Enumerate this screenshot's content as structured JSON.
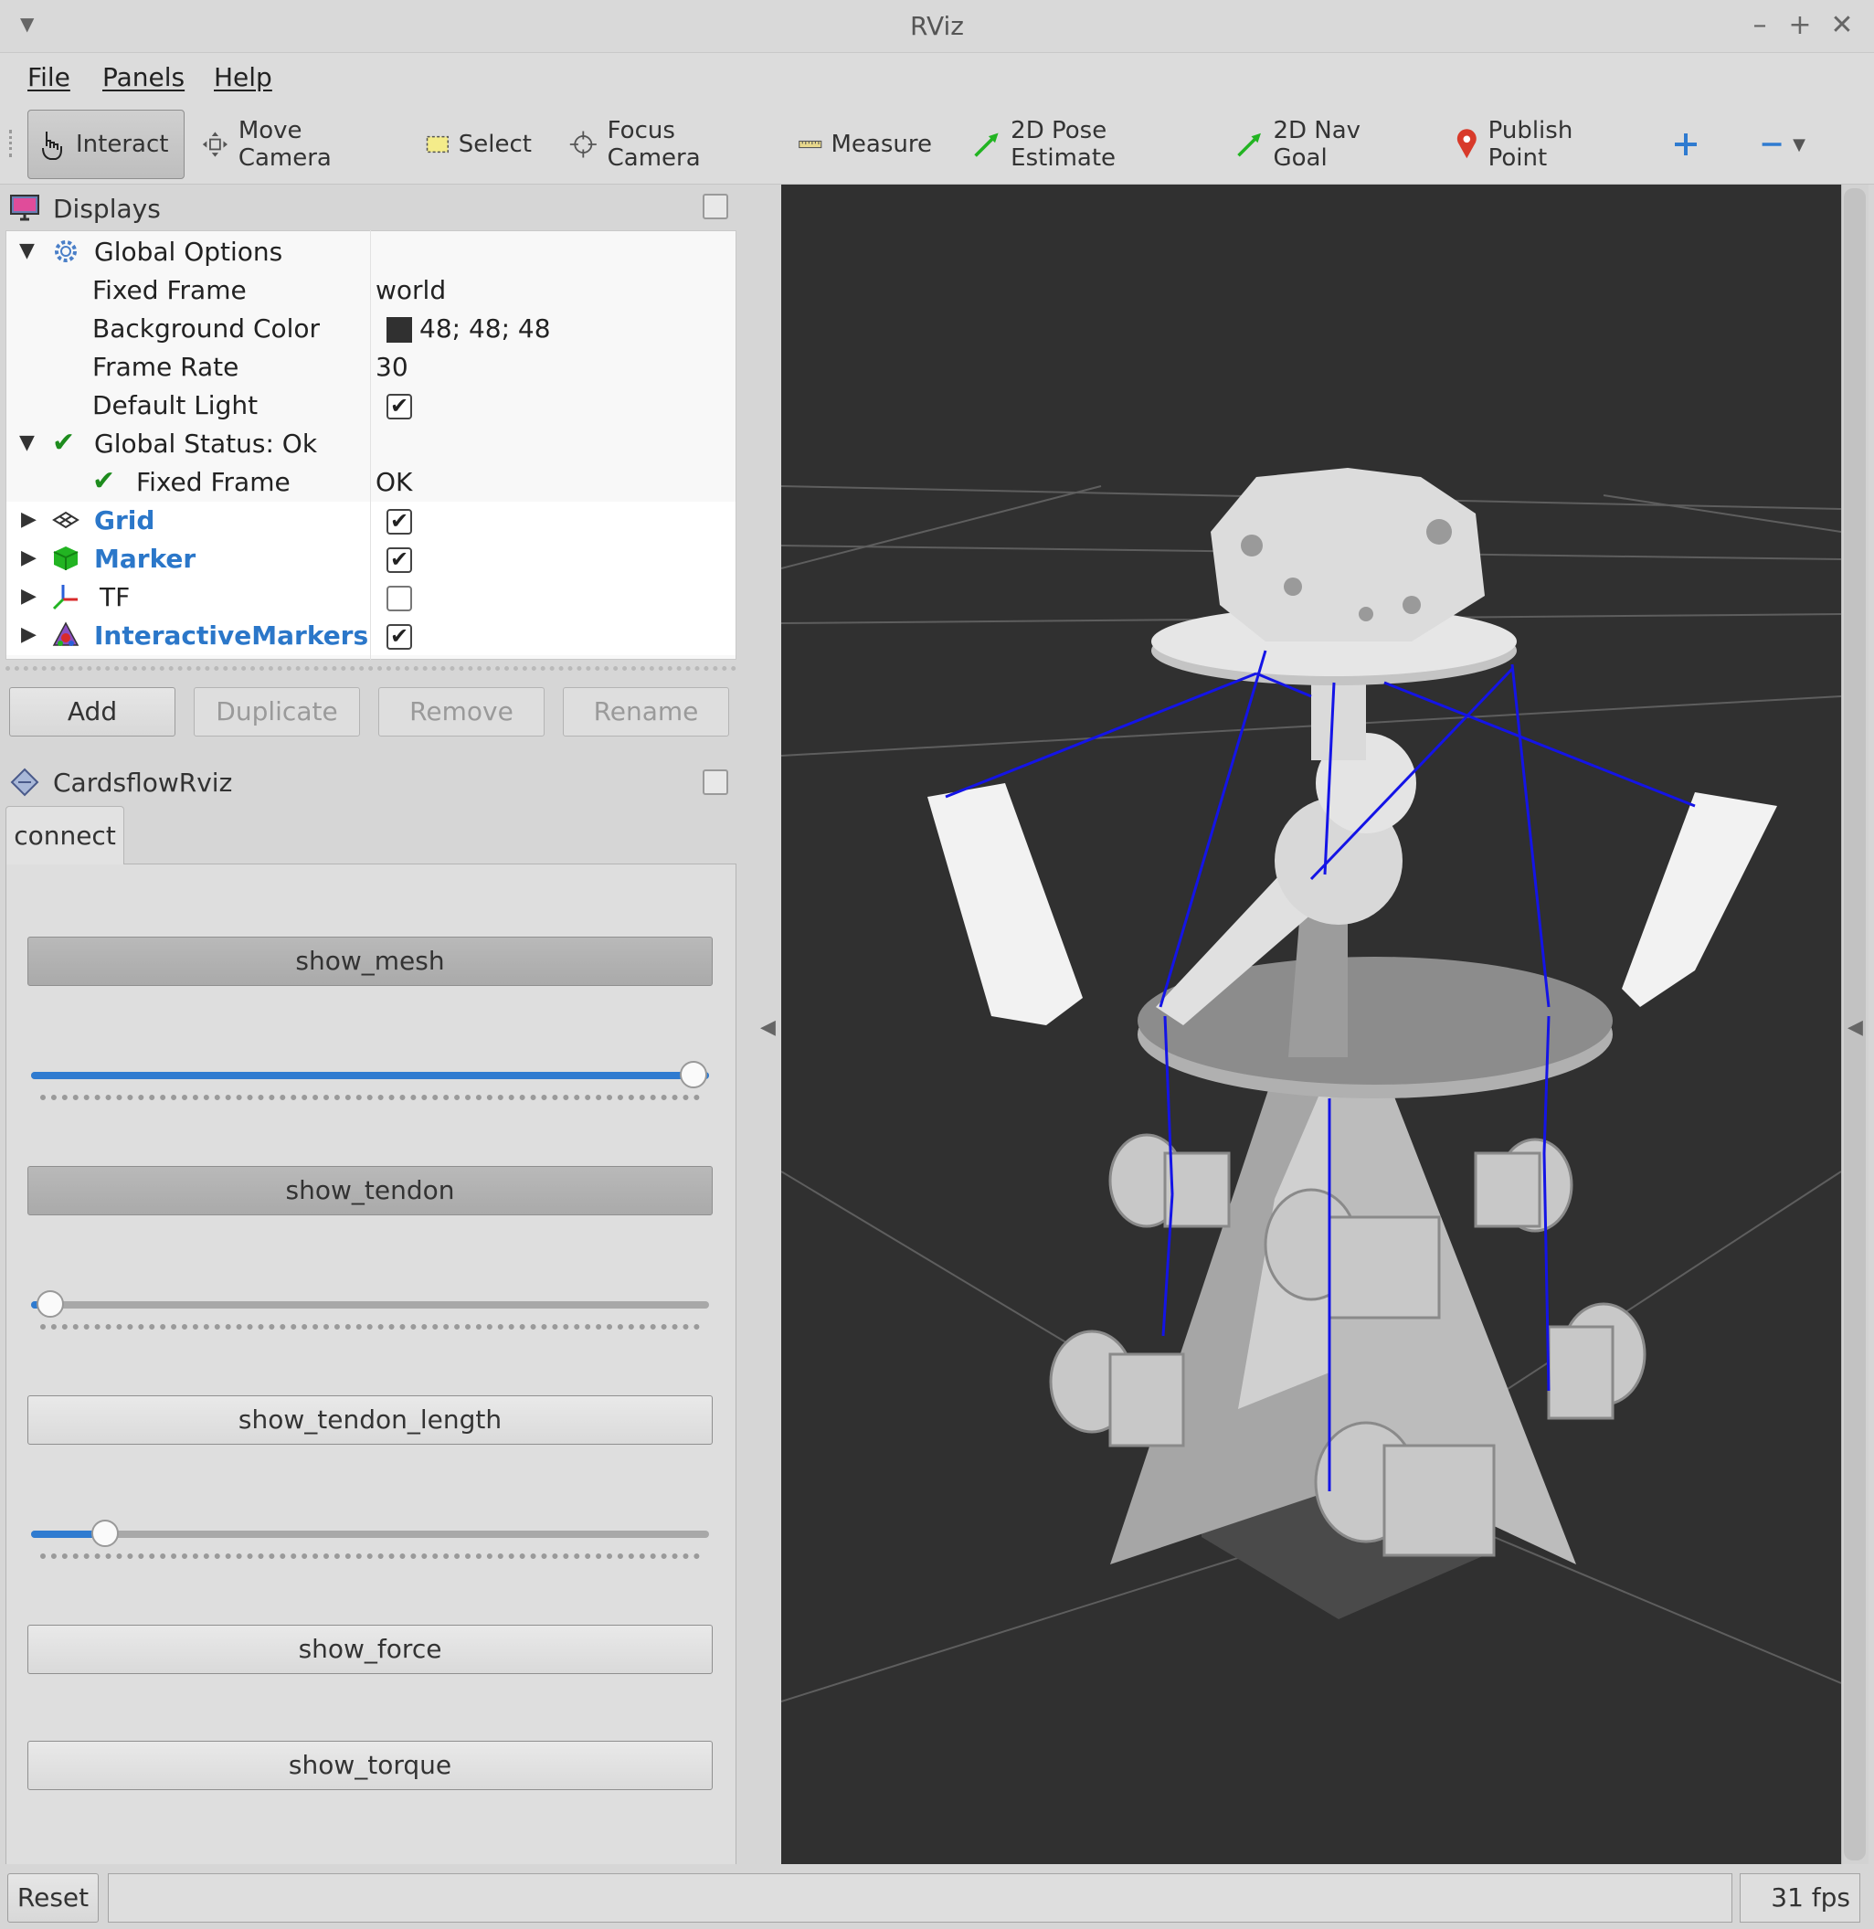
{
  "window": {
    "title": "RViz"
  },
  "menubar": {
    "items": [
      "File",
      "Panels",
      "Help"
    ]
  },
  "toolbar": {
    "tools": [
      {
        "label": "Interact",
        "icon": "hand-pointer-icon"
      },
      {
        "label": "Move Camera",
        "icon": "move-arrows-icon"
      },
      {
        "label": "Select",
        "icon": "select-rectangle-icon"
      },
      {
        "label": "Focus Camera",
        "icon": "crosshair-icon"
      },
      {
        "label": "Measure",
        "icon": "ruler-icon"
      },
      {
        "label": "2D Pose Estimate",
        "icon": "green-arrow-icon"
      },
      {
        "label": "2D Nav Goal",
        "icon": "green-arrow-icon"
      },
      {
        "label": "Publish Point",
        "icon": "map-pin-icon"
      }
    ],
    "add_tool_icon": "plus-icon",
    "remove_tool_icon": "minus-icon"
  },
  "displays": {
    "title": "Displays",
    "global_options": "Global Options",
    "fixed_frame_label": "Fixed Frame",
    "fixed_frame_value": "world",
    "background_color_label": "Background Color",
    "background_color_value": "48; 48; 48",
    "background_color_swatch": "#303030",
    "frame_rate_label": "Frame Rate",
    "frame_rate_value": "30",
    "default_light_label": "Default Light",
    "default_light_checked": true,
    "global_status_label": "Global Status: Ok",
    "status_fixed_frame_label": "Fixed Frame",
    "status_fixed_frame_value": "OK",
    "items": [
      {
        "label": "Grid",
        "checked": true
      },
      {
        "label": "Marker",
        "checked": true
      },
      {
        "label": "TF",
        "checked": false
      },
      {
        "label": "InteractiveMarkers",
        "checked": true
      }
    ],
    "buttons": {
      "add": "Add",
      "duplicate": "Duplicate",
      "remove": "Remove",
      "rename": "Rename"
    }
  },
  "cardsflow": {
    "title": "CardsflowRviz",
    "tab": "connect",
    "buttons": {
      "show_mesh": "show_mesh",
      "show_tendon": "show_tendon",
      "show_tendon_length": "show_tendon_length",
      "show_force": "show_force",
      "show_torque": "show_torque"
    },
    "sliders": {
      "mesh": 1.0,
      "tendon": 0.03,
      "tendon_length": 0.11
    }
  },
  "statusbar": {
    "reset": "Reset",
    "fps": "31 fps"
  },
  "colors": {
    "viewport_bg": "#303030",
    "tendon": "#1414e6",
    "accent": "#2f7bd0",
    "link_blue": "#2b77c9"
  }
}
